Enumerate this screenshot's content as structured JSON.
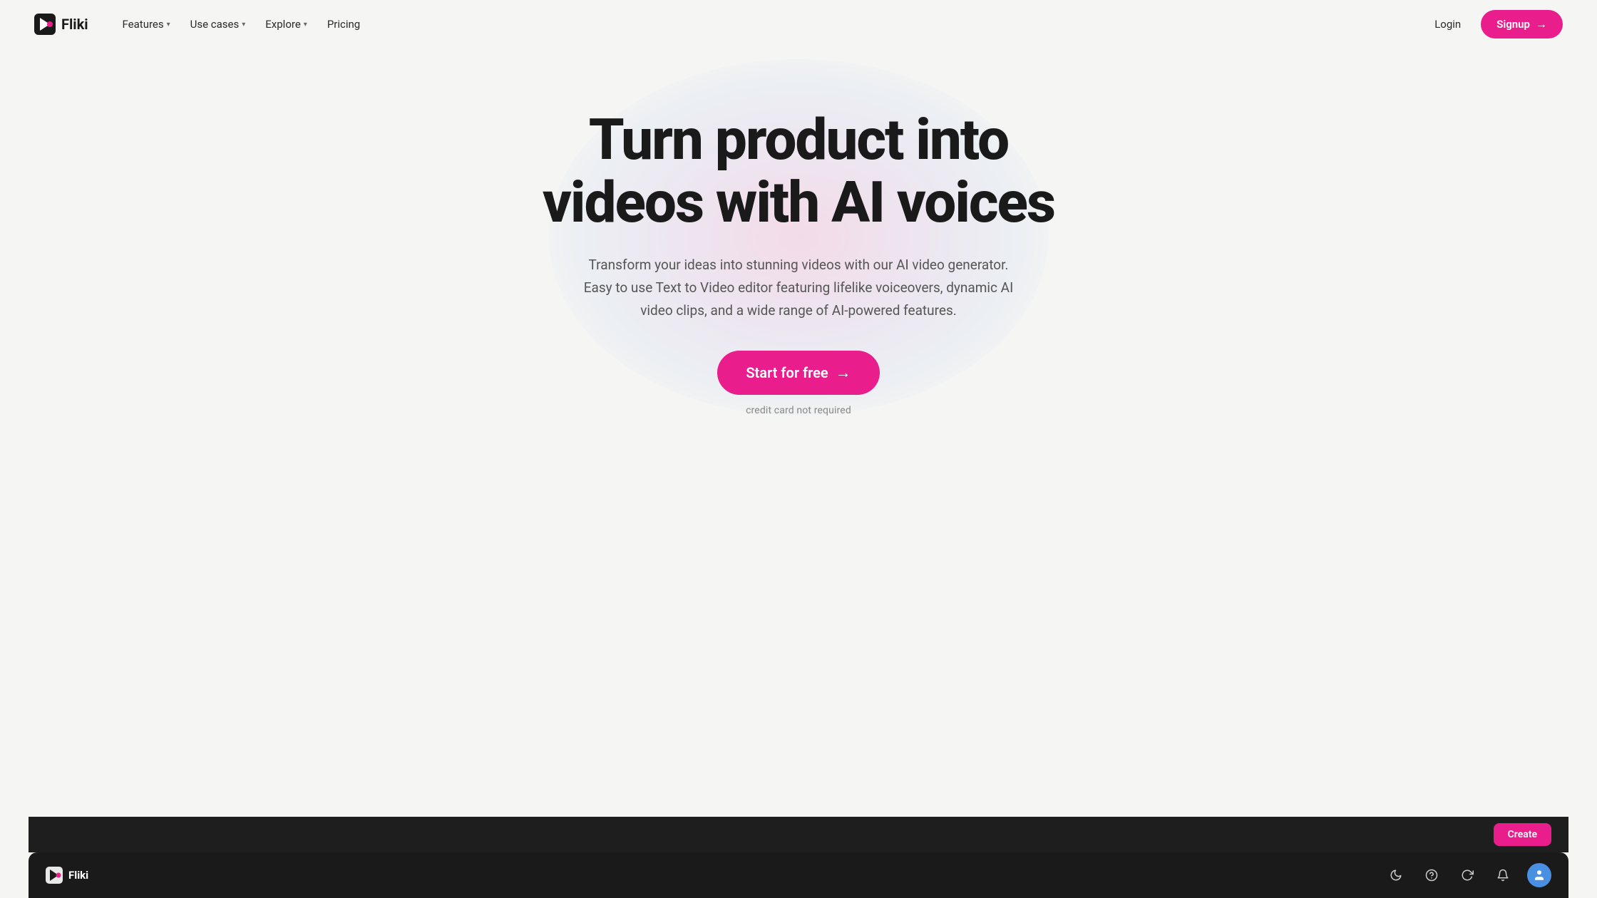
{
  "navbar": {
    "logo_text": "Fliki",
    "nav_items": [
      {
        "label": "Features",
        "has_dropdown": true
      },
      {
        "label": "Use cases",
        "has_dropdown": true
      },
      {
        "label": "Explore",
        "has_dropdown": true
      },
      {
        "label": "Pricing",
        "has_dropdown": false
      }
    ],
    "login_label": "Login",
    "signup_label": "Signup",
    "signup_arrow": "→"
  },
  "hero": {
    "title_line1": "Turn product into",
    "title_line2": "videos with AI voices",
    "subtitle": "Transform your ideas into stunning videos with our AI video generator. Easy to use Text to Video editor featuring lifelike voiceovers, dynamic AI video clips, and a wide range of AI-powered features.",
    "cta_label": "Start for free",
    "cta_arrow": "→",
    "credit_note": "credit card not required"
  },
  "bottom_bar": {
    "logo_text": "Fliki",
    "icons": [
      {
        "name": "moon-icon",
        "symbol": "☽"
      },
      {
        "name": "help-icon",
        "symbol": "?"
      },
      {
        "name": "refresh-icon",
        "symbol": "↻"
      },
      {
        "name": "bell-icon",
        "symbol": "🔔"
      },
      {
        "name": "user-avatar",
        "symbol": "👤"
      }
    ]
  }
}
